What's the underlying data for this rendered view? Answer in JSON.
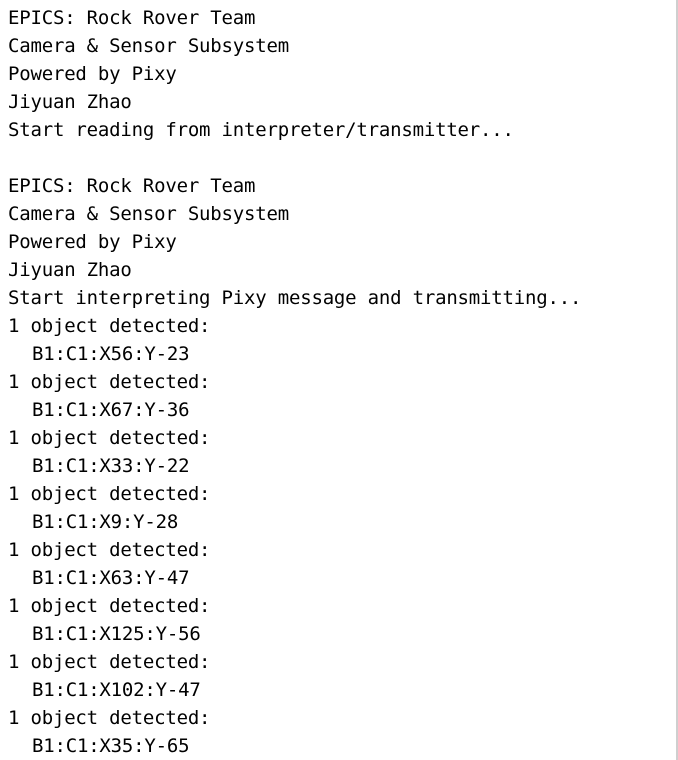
{
  "terminal": {
    "session1": {
      "team": "EPICS: Rock Rover Team",
      "subsystem": "Camera & Sensor Subsystem",
      "powered": "Powered by Pixy",
      "author": "Jiyuan Zhao",
      "status": "Start reading from interpreter/transmitter..."
    },
    "session2": {
      "team": "EPICS: Rock Rover Team",
      "subsystem": "Camera & Sensor Subsystem",
      "powered": "Powered by Pixy",
      "author": "Jiyuan Zhao",
      "status": "Start interpreting Pixy message and transmitting..."
    },
    "detections": [
      {
        "message": "1 object detected:",
        "data": "B1:C1:X56:Y-23"
      },
      {
        "message": "1 object detected:",
        "data": "B1:C1:X67:Y-36"
      },
      {
        "message": "1 object detected:",
        "data": "B1:C1:X33:Y-22"
      },
      {
        "message": "1 object detected:",
        "data": "B1:C1:X9:Y-28"
      },
      {
        "message": "1 object detected:",
        "data": "B1:C1:X63:Y-47"
      },
      {
        "message": "1 object detected:",
        "data": "B1:C1:X125:Y-56"
      },
      {
        "message": "1 object detected:",
        "data": "B1:C1:X102:Y-47"
      },
      {
        "message": "1 object detected:",
        "data": "B1:C1:X35:Y-65"
      }
    ]
  }
}
